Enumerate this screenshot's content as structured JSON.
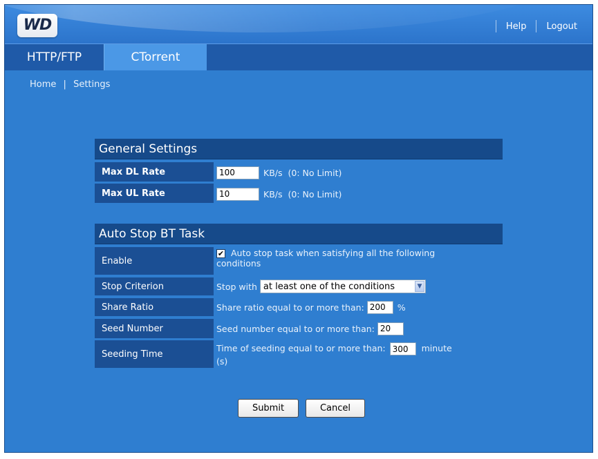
{
  "header": {
    "logo_text": "WD",
    "help_label": "Help",
    "logout_label": "Logout"
  },
  "tabs": [
    {
      "label": "HTTP/FTP",
      "active": false
    },
    {
      "label": "CTorrent",
      "active": true
    }
  ],
  "breadcrumb": {
    "home": "Home",
    "separator": "|",
    "current": "Settings"
  },
  "general_settings": {
    "title": "General Settings",
    "max_dl": {
      "label": "Max DL Rate",
      "value": "100",
      "unit": "KB/s",
      "note": "(0: No Limit)"
    },
    "max_ul": {
      "label": "Max UL Rate",
      "value": "10",
      "unit": "KB/s",
      "note": "(0: No Limit)"
    }
  },
  "auto_stop": {
    "title": "Auto Stop BT Task",
    "enable": {
      "label": "Enable",
      "checked": true,
      "text_line1": "Auto stop task when satisfying all the following",
      "text_line2": "conditions"
    },
    "stop_criterion": {
      "label": "Stop Criterion",
      "prefix": "Stop with",
      "selected": "at least one of the conditions"
    },
    "share_ratio": {
      "label": "Share Ratio",
      "prefix": "Share ratio equal to or more than:",
      "value": "200",
      "unit": "%"
    },
    "seed_number": {
      "label": "Seed Number",
      "prefix": "Seed number equal to or more than:",
      "value": "20"
    },
    "seeding_time": {
      "label": "Seeding Time",
      "prefix": "Time of seeding equal to or more than:",
      "value": "300",
      "unit_line1": "minute",
      "unit_line2": "(s)"
    }
  },
  "buttons": {
    "submit": "Submit",
    "cancel": "Cancel"
  },
  "colors": {
    "background": "#2f7ed0",
    "section_header": "#164a8a",
    "label_cell": "#1b4f94",
    "active_tab": "#4b98e6"
  }
}
